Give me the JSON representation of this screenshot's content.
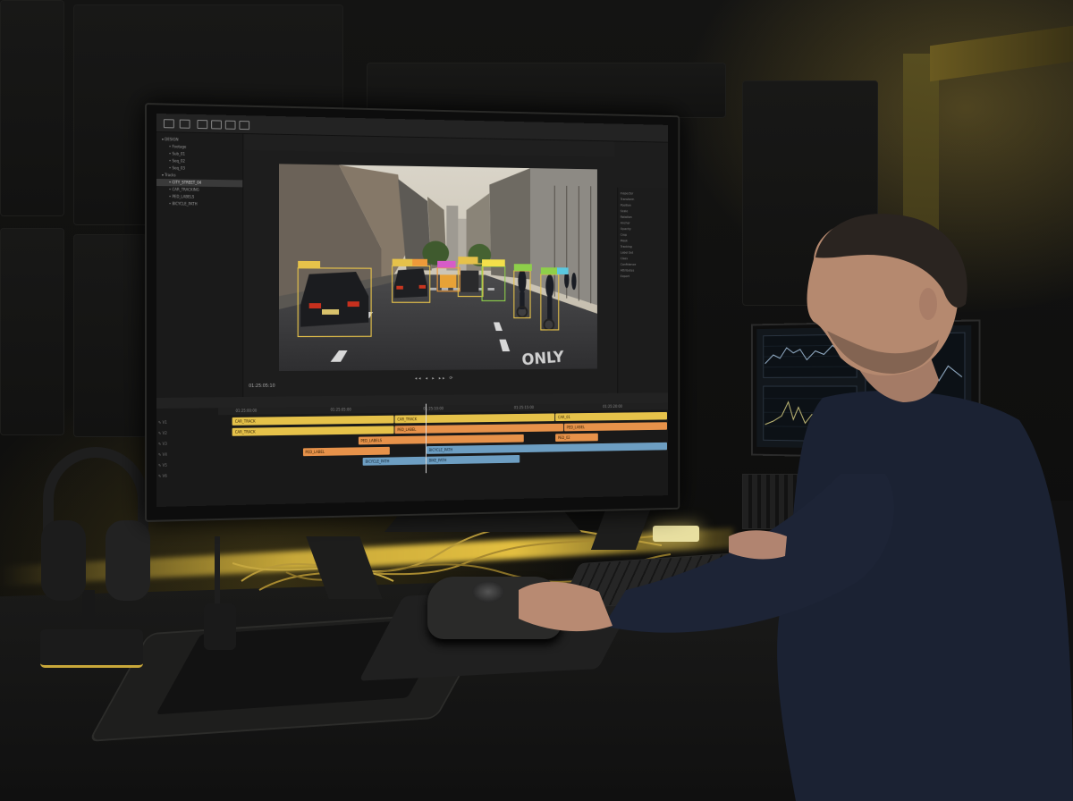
{
  "scene": {
    "description_tags": [
      "editing-suite",
      "annotation-software",
      "street-scene",
      "operator"
    ]
  },
  "editor": {
    "left_panel": {
      "rows": [
        {
          "label": "DESIGN",
          "selected": false
        },
        {
          "label": "Footage",
          "selected": false
        },
        {
          "label": "Sub_01",
          "selected": false
        },
        {
          "label": "Seq_02",
          "selected": false
        },
        {
          "label": "Seq_03",
          "selected": false
        },
        {
          "label": "Tracks",
          "selected": false
        },
        {
          "label": "CITY_STREET_04",
          "selected": true
        },
        {
          "label": "CAR_TRACKING",
          "selected": false
        },
        {
          "label": "PED_LABELS",
          "selected": false
        },
        {
          "label": "BICYCLE_PATH",
          "selected": false
        }
      ]
    },
    "viewer": {
      "timecode": "01:25:05:10",
      "transport": "◂◂ ◂ ▸ ▸▸ ⟳",
      "street_text": "ONLY",
      "detection_colors": [
        "#e6c24a",
        "#ef9a3a",
        "#d65cc8",
        "#8ecf4a",
        "#5ac8e0",
        "#f4e04a"
      ]
    },
    "properties": {
      "rows": [
        "Inspector",
        "Transform",
        "Position",
        "Scale",
        "Rotation",
        "Anchor",
        "Opacity",
        "Crop",
        "Mask",
        "Tracking",
        "Label Set",
        "Class",
        "Confidence",
        "Attributes",
        "Export"
      ]
    },
    "timeline": {
      "ruler": [
        "01:25:00:00",
        "01:25:05:00",
        "01:25:10:00",
        "01:25:15:00",
        "01:25:20:00"
      ],
      "track_labels": [
        "V1",
        "V2",
        "V3",
        "V4",
        "V5",
        "V6"
      ],
      "clips": [
        {
          "track": 0,
          "start": 0.03,
          "end": 0.38,
          "color": "y",
          "label": "CAR_TRACK"
        },
        {
          "track": 0,
          "start": 0.38,
          "end": 0.74,
          "color": "y",
          "label": "CAR_TRACK"
        },
        {
          "track": 0,
          "start": 0.74,
          "end": 1.0,
          "color": "y",
          "label": "CAR_01"
        },
        {
          "track": 1,
          "start": 0.03,
          "end": 0.38,
          "color": "y",
          "label": "CAR_TRACK"
        },
        {
          "track": 1,
          "start": 0.38,
          "end": 0.76,
          "color": "o",
          "label": "PED_LABEL"
        },
        {
          "track": 1,
          "start": 0.76,
          "end": 1.0,
          "color": "o",
          "label": "PED_LABEL"
        },
        {
          "track": 2,
          "start": 0.3,
          "end": 0.67,
          "color": "o",
          "label": "PED_LABELS"
        },
        {
          "track": 2,
          "start": 0.74,
          "end": 0.84,
          "color": "o",
          "label": "PED_02"
        },
        {
          "track": 3,
          "start": 0.18,
          "end": 0.37,
          "color": "o",
          "label": "PED_LABEL"
        },
        {
          "track": 3,
          "start": 0.45,
          "end": 1.0,
          "color": "b",
          "label": "BICYCLE_PATH"
        },
        {
          "track": 4,
          "start": 0.31,
          "end": 0.45,
          "color": "b",
          "label": "BICYCLE_PATH"
        },
        {
          "track": 4,
          "start": 0.45,
          "end": 0.66,
          "color": "b",
          "label": "BIKE_PATH"
        }
      ]
    }
  },
  "colors": {
    "accent_yellow": "#e6c24a",
    "accent_orange": "#e7924a",
    "accent_blue": "#6d9ec2",
    "room_light": "#f0cc50"
  }
}
